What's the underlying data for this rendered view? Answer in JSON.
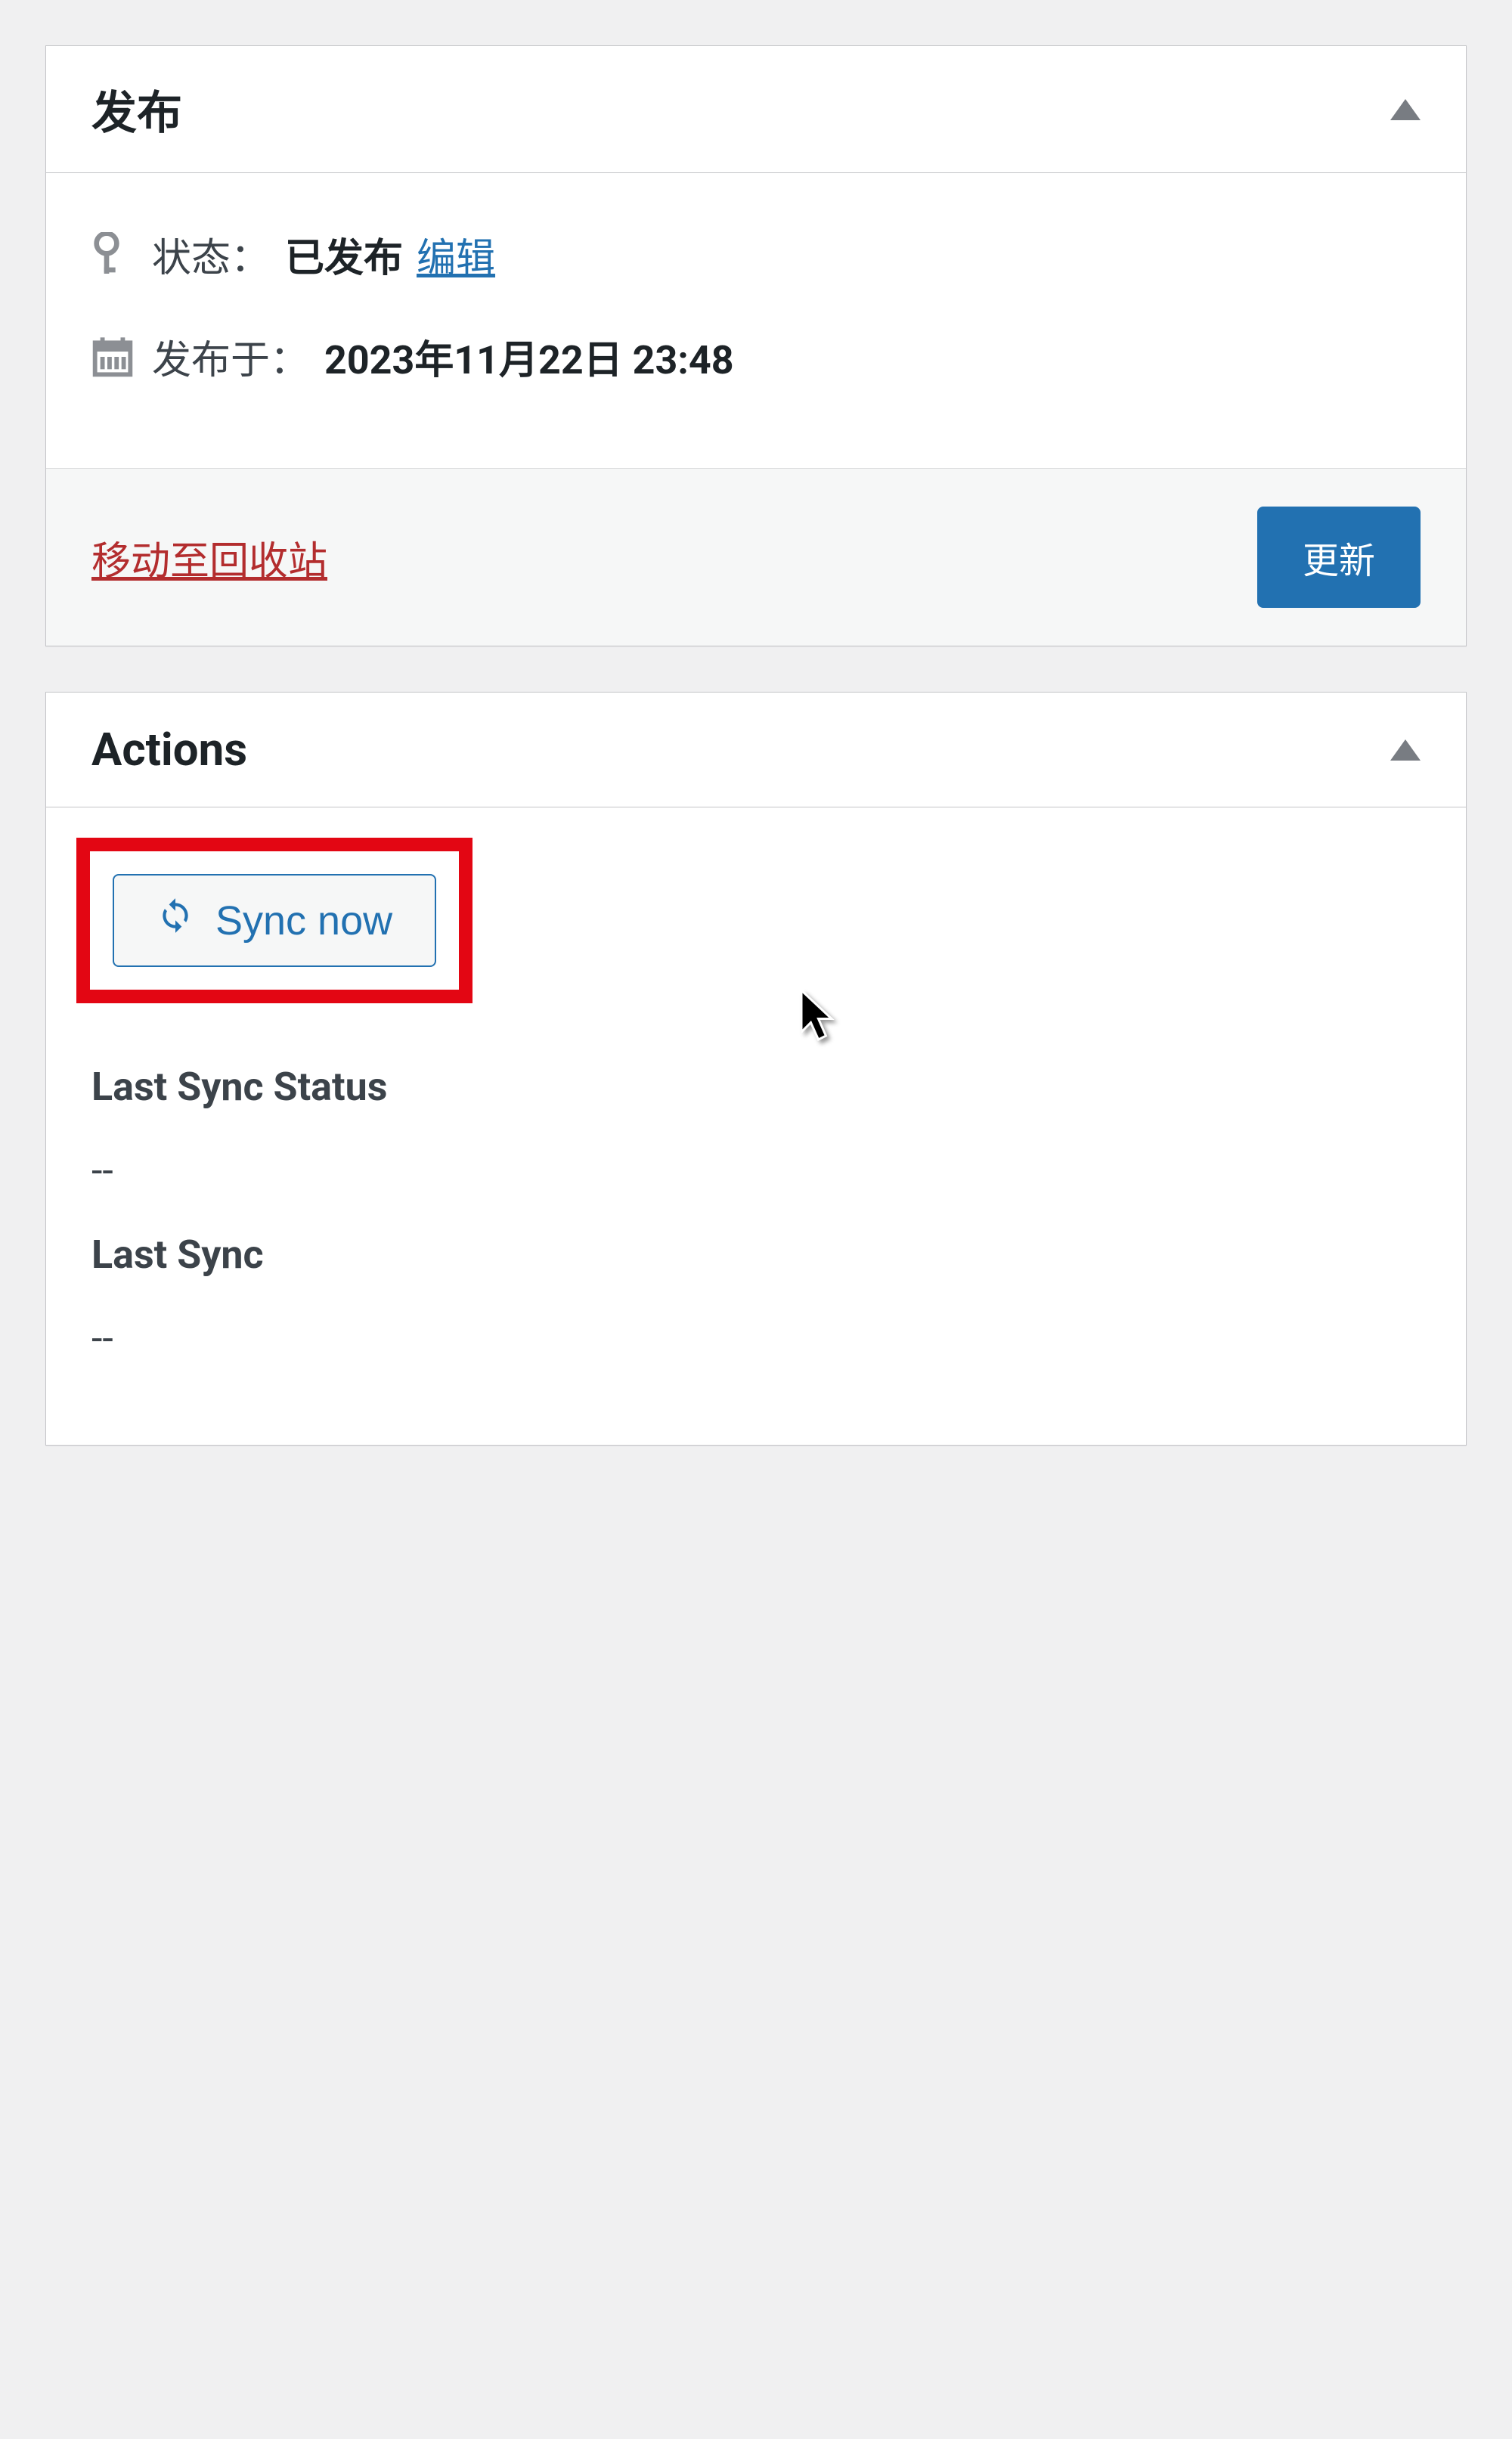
{
  "publish": {
    "panel_title": "发布",
    "status_label": "状态：",
    "status_value": "已发布",
    "edit_link": "编辑",
    "publish_on_label": "发布于：",
    "publish_date": "2023年11月22日 23:48",
    "trash_link": "移动至回收站",
    "update_button": "更新"
  },
  "actions": {
    "panel_title": "Actions",
    "sync_button": "Sync now",
    "last_sync_status_label": "Last Sync Status",
    "last_sync_status_value": "--",
    "last_sync_label": "Last Sync",
    "last_sync_value": "--"
  }
}
